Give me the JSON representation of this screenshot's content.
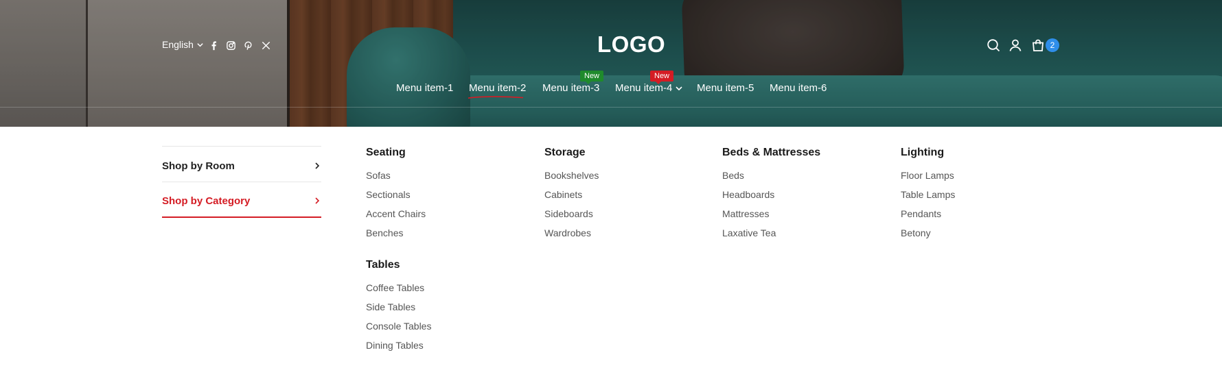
{
  "header": {
    "language": "English",
    "social_icons": [
      "facebook-icon",
      "instagram-icon",
      "pinterest-icon",
      "x-icon"
    ],
    "logo": "LOGO",
    "icons": [
      "search-icon",
      "account-icon",
      "cart-icon"
    ],
    "cart_count": "2"
  },
  "menu": {
    "items": [
      {
        "label": "Menu item-1"
      },
      {
        "label": "Menu item-2",
        "active": true
      },
      {
        "label": "Menu item-3",
        "tag": "New",
        "tag_color": "#1f8a2c"
      },
      {
        "label": "Menu item-4",
        "tag": "New",
        "tag_color": "#d41c24",
        "has_dropdown": true
      },
      {
        "label": "Menu item-5"
      },
      {
        "label": "Menu item-6"
      }
    ]
  },
  "mega_menu": {
    "sidebar": [
      {
        "label": "Shop by Room",
        "active": false
      },
      {
        "label": "Shop by Category",
        "active": true
      }
    ],
    "accent_color": "#d41c24",
    "columns": [
      {
        "title": "Seating",
        "links": [
          "Sofas",
          "Sectionals",
          "Accent Chairs",
          "Benches"
        ]
      },
      {
        "title": "Storage",
        "links": [
          "Bookshelves",
          "Cabinets",
          "Sideboards",
          "Wardrobes"
        ]
      },
      {
        "title": "Beds & Mattresses",
        "links": [
          "Beds",
          "Headboards",
          "Mattresses",
          "Laxative Tea"
        ]
      },
      {
        "title": "Lighting",
        "links": [
          "Floor Lamps",
          "Table Lamps",
          "Pendants",
          "Betony"
        ]
      },
      {
        "title": "Tables",
        "links": [
          "Coffee Tables",
          "Side Tables",
          "Console Tables",
          "Dining Tables"
        ]
      }
    ]
  }
}
